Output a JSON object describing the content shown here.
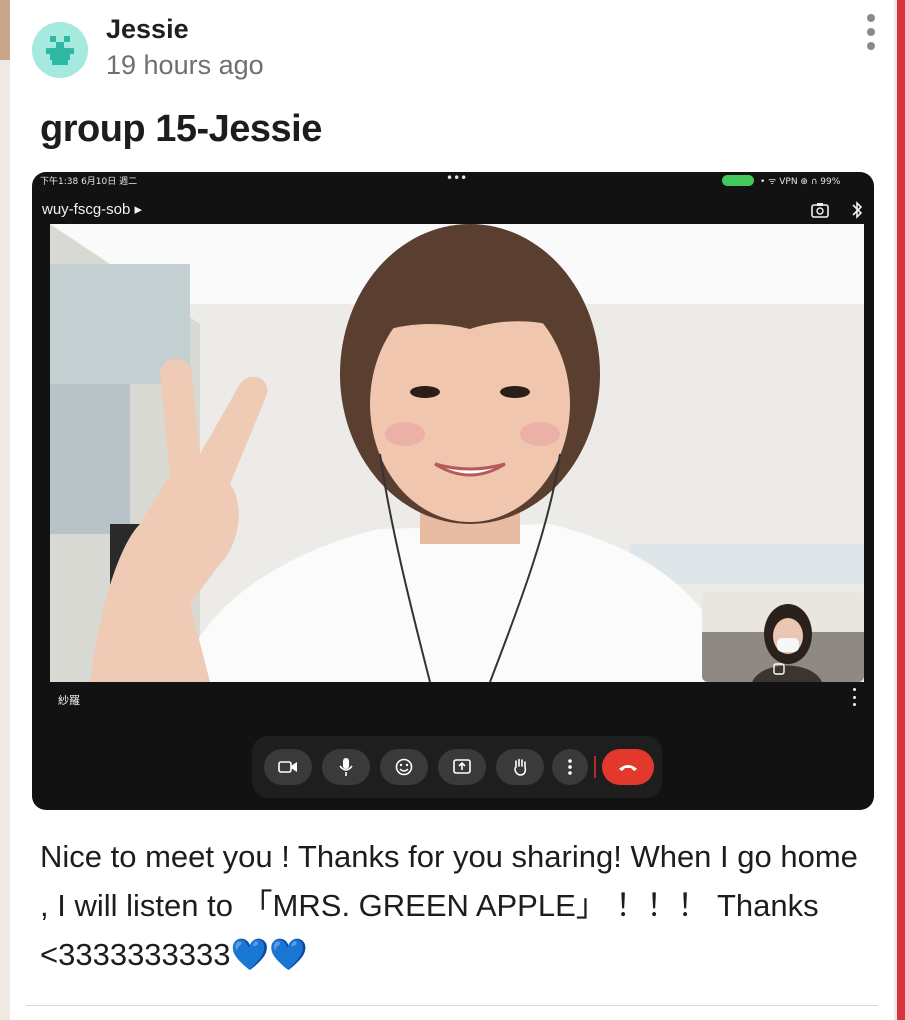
{
  "post": {
    "author": "Jessie",
    "timestamp": "19 hours ago",
    "title": "group 15-Jessie",
    "comment": "Nice to meet you ! Thanks for you sharing! When I go home , I will listen to 「MRS. GREEN APPLE」 ！！！ Thanks <3333333333💙💙",
    "avatar_color": "#a6eadf"
  },
  "screenshot": {
    "status_left": "下午1:38 6月10日 週二",
    "status_center": "•••",
    "status_right": "• ᯤ VPN ⊕ ∩ 99%",
    "meeting_code": "wuy-fscg-sob ▸",
    "participant_name": "紗羅",
    "accent_end_call": "#e3392c",
    "controls": [
      "camera",
      "microphone",
      "reactions",
      "present",
      "raise-hand",
      "more",
      "end-call"
    ]
  }
}
